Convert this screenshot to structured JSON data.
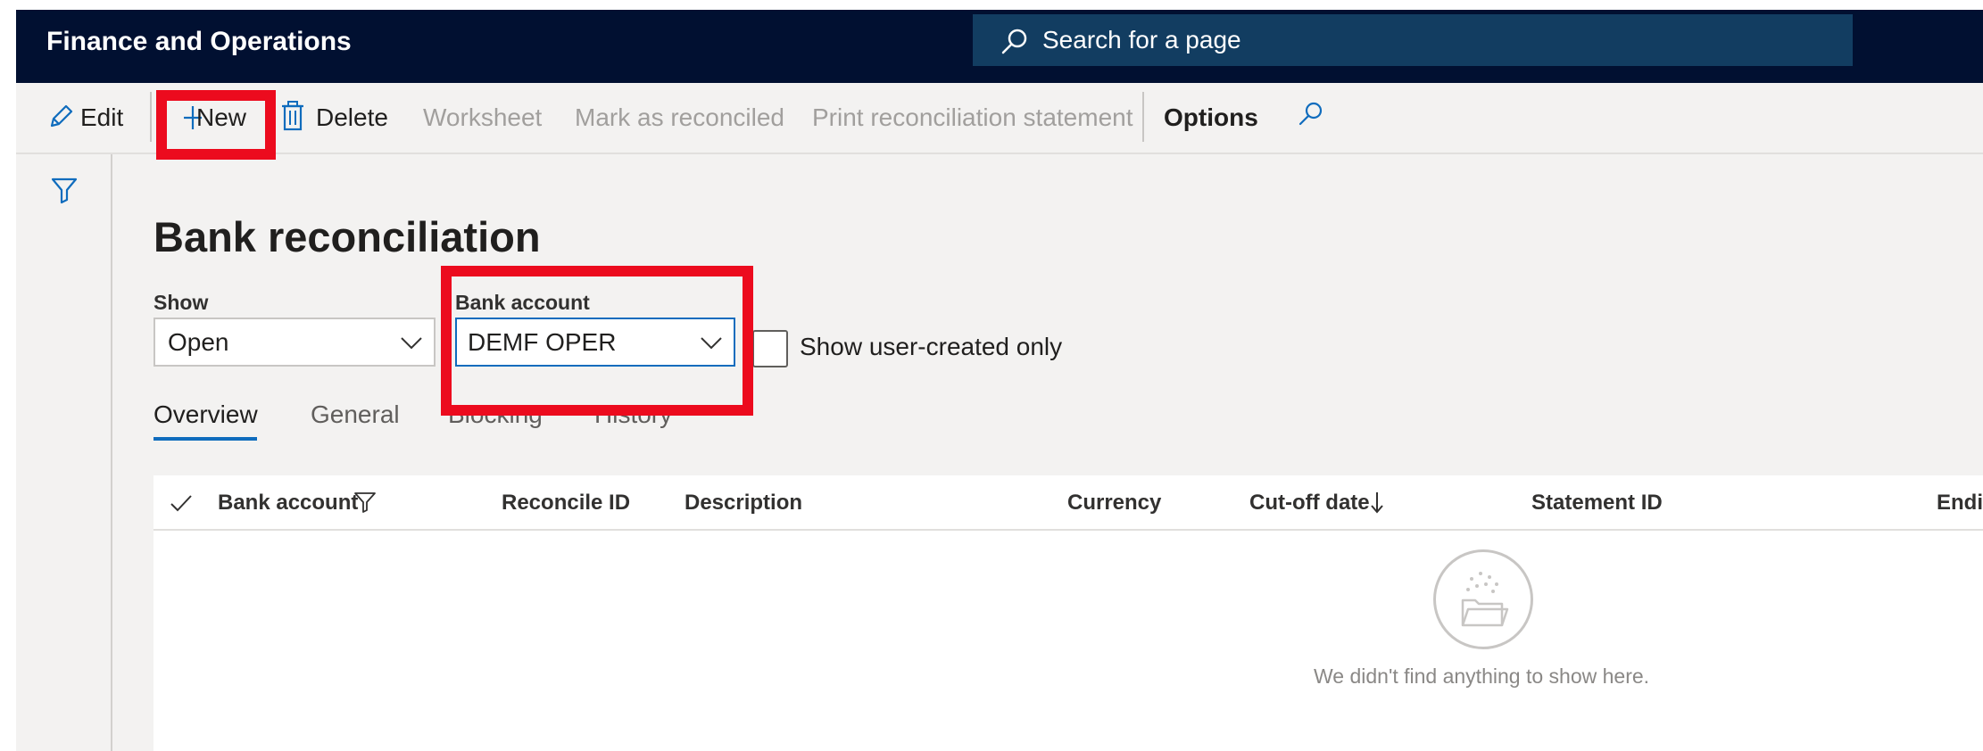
{
  "app": {
    "title": "Finance and Operations"
  },
  "search": {
    "placeholder": "Search for a page"
  },
  "actions": {
    "edit": "Edit",
    "new": "New",
    "delete": "Delete",
    "worksheet": "Worksheet",
    "mark_reconciled": "Mark as reconciled",
    "print_statement": "Print reconciliation statement",
    "options": "Options"
  },
  "page": {
    "title": "Bank reconciliation"
  },
  "filters": {
    "show_label": "Show",
    "show_value": "Open",
    "bank_account_label": "Bank account",
    "bank_account_value": "DEMF OPER",
    "user_created_label": "Show user-created only",
    "user_created_checked": false
  },
  "tabs": [
    {
      "label": "Overview",
      "active": true
    },
    {
      "label": "General",
      "active": false
    },
    {
      "label": "Blocking",
      "active": false
    },
    {
      "label": "History",
      "active": false
    }
  ],
  "grid": {
    "columns": [
      "Bank account",
      "Reconcile ID",
      "Description",
      "Currency",
      "Cut-off date",
      "Statement ID",
      "Endir"
    ],
    "empty_message": "We didn't find anything to show here."
  },
  "icons": [
    "pencil-icon",
    "plus-icon",
    "trash-icon",
    "search-icon",
    "filter-icon",
    "checkmark-icon",
    "sort-down-icon",
    "empty-folder-icon",
    "chevron-down-icon"
  ],
  "colors": {
    "nav_bg": "#011031",
    "search_bg": "#123d61",
    "accent": "#0f6cbd",
    "highlight": "#ec0b1e"
  }
}
